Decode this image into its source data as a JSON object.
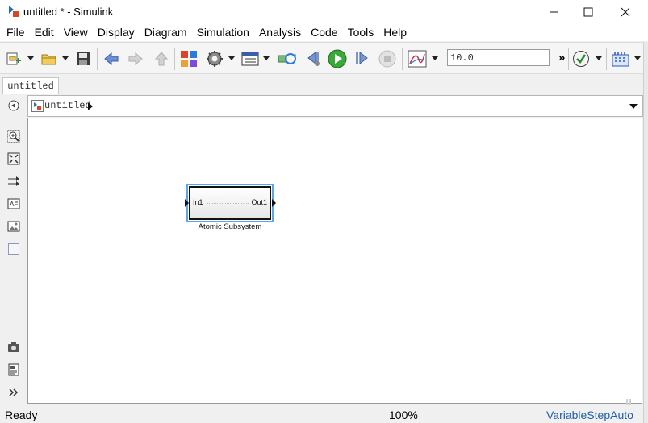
{
  "window": {
    "title": "untitled * - Simulink",
    "controls": [
      "minimize",
      "maximize",
      "close"
    ]
  },
  "menu": {
    "items": [
      "File",
      "Edit",
      "View",
      "Display",
      "Diagram",
      "Simulation",
      "Analysis",
      "Code",
      "Tools",
      "Help"
    ]
  },
  "toolbar": {
    "stop_time": "10.0",
    "overflow_label": "»",
    "icons": [
      "new-model-icon",
      "open-icon",
      "save-icon",
      "back-icon",
      "forward-icon",
      "up-icon",
      "library-browser-icon",
      "model-config-icon",
      "model-explorer-icon",
      "update-diagram-icon",
      "step-back-icon",
      "run-icon",
      "step-forward-icon",
      "stop-icon",
      "data-inspector-icon",
      "model-advisor-icon",
      "build-icon"
    ]
  },
  "tabs": [
    {
      "label": "untitled"
    }
  ],
  "address_bar": {
    "path": "untitled"
  },
  "palette": {
    "tools": [
      "hide-explorer-icon",
      "zoom-icon",
      "fit-view-icon",
      "signal-routing-icon",
      "annotation-icon",
      "image-icon",
      "area-icon",
      "snapshot-icon",
      "report-icon",
      "expand-icon"
    ]
  },
  "canvas": {
    "block": {
      "name": "Atomic Subsystem",
      "input_port": "In1",
      "output_port": "Out1",
      "selected": true
    }
  },
  "status": {
    "left": "Ready",
    "zoom": "100%",
    "solver": "VariableStepAuto"
  },
  "colors": {
    "selection": "#5aa6e8",
    "run_green": "#3aa83a",
    "link_blue": "#1f5fa6"
  }
}
